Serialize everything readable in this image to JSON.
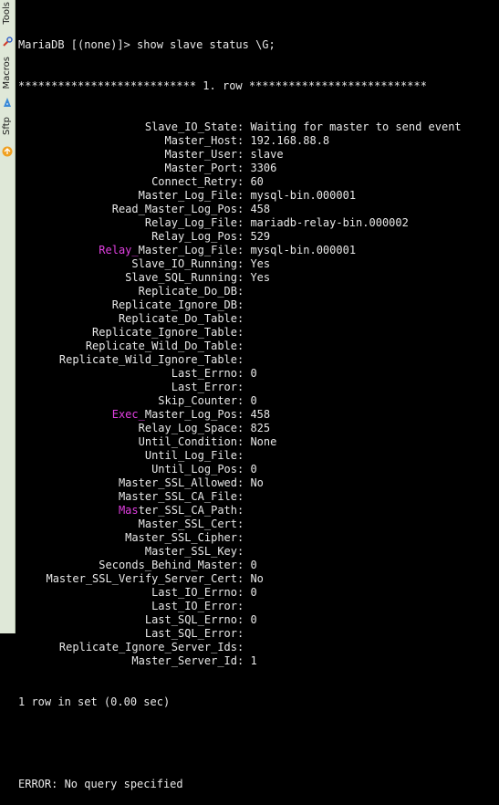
{
  "sidebar": {
    "tabs": [
      {
        "label": "Tools",
        "icon": "tools-icon"
      },
      {
        "label": "Macros",
        "icon": "macros-icon"
      },
      {
        "label": "Sftp",
        "icon": "sftp-icon"
      }
    ]
  },
  "terminal": {
    "prompt_line": "MariaDB [(none)]> show slave status \\G;",
    "row_header": "*************************** 1. row ***************************",
    "fields": [
      {
        "name": "Slave_IO_State",
        "value": "Waiting for master to send event"
      },
      {
        "name": "Master_Host",
        "value": "192.168.88.8"
      },
      {
        "name": "Master_User",
        "value": "slave"
      },
      {
        "name": "Master_Port",
        "value": "3306"
      },
      {
        "name": "Connect_Retry",
        "value": "60"
      },
      {
        "name": "Master_Log_File",
        "value": "mysql-bin.000001"
      },
      {
        "name": "Read_Master_Log_Pos",
        "value": "458"
      },
      {
        "name": "Relay_Log_File",
        "value": "mariadb-relay-bin.000002"
      },
      {
        "name": "Relay_Log_Pos",
        "value": "529"
      },
      {
        "name": "Relay_Master_Log_File",
        "value": "mysql-bin.000001",
        "highlight": "Relay_"
      },
      {
        "name": "Slave_IO_Running",
        "value": "Yes"
      },
      {
        "name": "Slave_SQL_Running",
        "value": "Yes"
      },
      {
        "name": "Replicate_Do_DB",
        "value": ""
      },
      {
        "name": "Replicate_Ignore_DB",
        "value": ""
      },
      {
        "name": "Replicate_Do_Table",
        "value": ""
      },
      {
        "name": "Replicate_Ignore_Table",
        "value": ""
      },
      {
        "name": "Replicate_Wild_Do_Table",
        "value": ""
      },
      {
        "name": "Replicate_Wild_Ignore_Table",
        "value": ""
      },
      {
        "name": "Last_Errno",
        "value": "0"
      },
      {
        "name": "Last_Error",
        "value": ""
      },
      {
        "name": "Skip_Counter",
        "value": "0"
      },
      {
        "name": "Exec_Master_Log_Pos",
        "value": "458",
        "highlight": "Exec_"
      },
      {
        "name": "Relay_Log_Space",
        "value": "825"
      },
      {
        "name": "Until_Condition",
        "value": "None"
      },
      {
        "name": "Until_Log_File",
        "value": ""
      },
      {
        "name": "Until_Log_Pos",
        "value": "0"
      },
      {
        "name": "Master_SSL_Allowed",
        "value": "No"
      },
      {
        "name": "Master_SSL_CA_File",
        "value": ""
      },
      {
        "name": "Master_SSL_CA_Path",
        "value": "",
        "highlight": "Mas"
      },
      {
        "name": "Master_SSL_Cert",
        "value": ""
      },
      {
        "name": "Master_SSL_Cipher",
        "value": ""
      },
      {
        "name": "Master_SSL_Key",
        "value": ""
      },
      {
        "name": "Seconds_Behind_Master",
        "value": "0"
      },
      {
        "name": "Master_SSL_Verify_Server_Cert",
        "value": "No"
      },
      {
        "name": "Last_IO_Errno",
        "value": "0"
      },
      {
        "name": "Last_IO_Error",
        "value": ""
      },
      {
        "name": "Last_SQL_Errno",
        "value": "0"
      },
      {
        "name": "Last_SQL_Error",
        "value": ""
      },
      {
        "name": "Replicate_Ignore_Server_Ids",
        "value": ""
      },
      {
        "name": "Master_Server_Id",
        "value": "1"
      }
    ],
    "result_line": "1 row in set (0.00 sec)",
    "error_line": "ERROR: No query specified",
    "colors": {
      "text": "#e8e8e8",
      "highlight": "#e03fe0",
      "background": "#000000"
    }
  }
}
